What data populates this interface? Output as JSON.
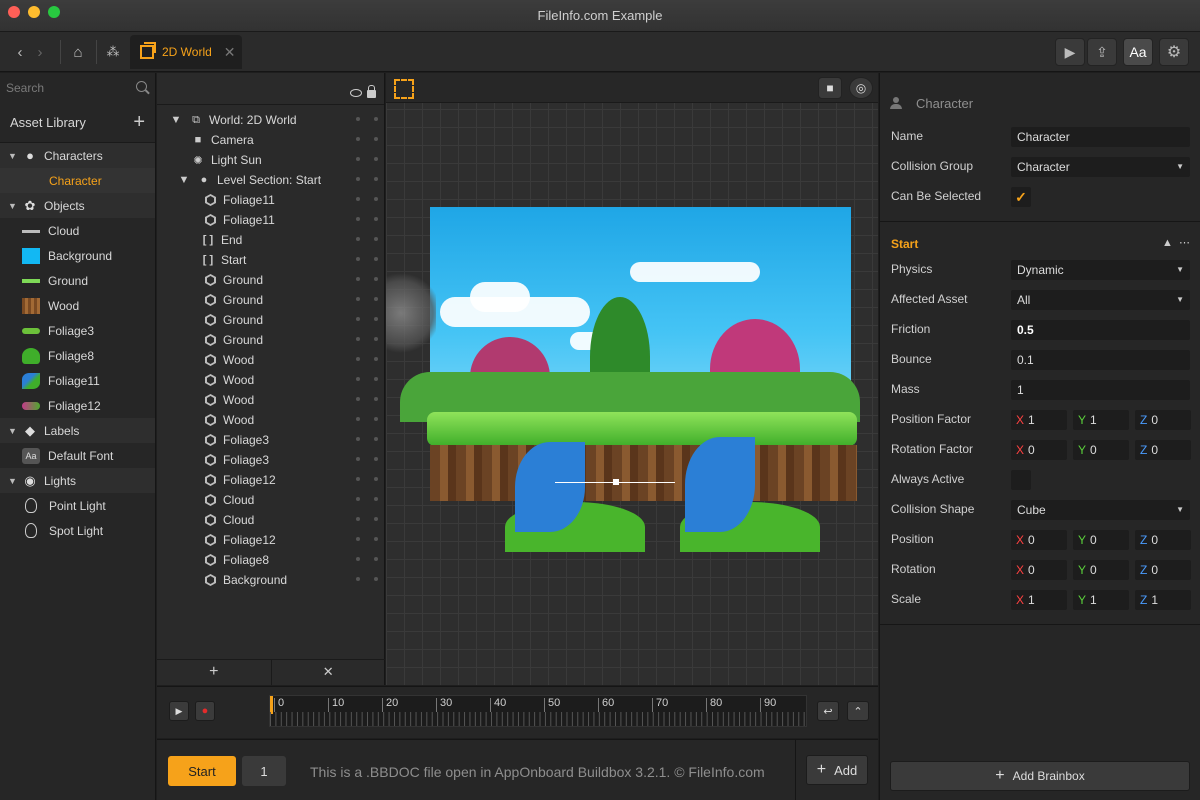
{
  "window": {
    "title": "FileInfo.com Example"
  },
  "toolbar": {
    "tab_label": "2D World",
    "tab_close": "✕"
  },
  "assets": {
    "search_placeholder": "Search",
    "header": "Asset Library",
    "groups": [
      {
        "label": "Characters",
        "items": [
          "Character"
        ]
      },
      {
        "label": "Objects",
        "items": [
          "Cloud",
          "Background",
          "Ground",
          "Wood",
          "Foliage3",
          "Foliage8",
          "Foliage11",
          "Foliage12"
        ]
      },
      {
        "label": "Labels",
        "items": [
          "Default Font"
        ]
      },
      {
        "label": "Lights",
        "items": [
          "Point Light",
          "Spot Light"
        ]
      }
    ]
  },
  "tree": {
    "world": "World: 2D World",
    "camera": "Camera",
    "light": "Light Sun",
    "section": "Level Section: Start",
    "objects": [
      {
        "icon": "hex",
        "label": "Foliage11"
      },
      {
        "icon": "hex",
        "label": "Foliage11"
      },
      {
        "icon": "bracket",
        "label": "End"
      },
      {
        "icon": "bracket",
        "label": "Start"
      },
      {
        "icon": "hex",
        "label": "Ground"
      },
      {
        "icon": "hex",
        "label": "Ground"
      },
      {
        "icon": "hex",
        "label": "Ground"
      },
      {
        "icon": "hex",
        "label": "Ground"
      },
      {
        "icon": "hex",
        "label": "Wood"
      },
      {
        "icon": "hex",
        "label": "Wood"
      },
      {
        "icon": "hex",
        "label": "Wood"
      },
      {
        "icon": "hex",
        "label": "Wood"
      },
      {
        "icon": "hex",
        "label": "Foliage3"
      },
      {
        "icon": "hex",
        "label": "Foliage3"
      },
      {
        "icon": "hex",
        "label": "Foliage12"
      },
      {
        "icon": "hex",
        "label": "Cloud"
      },
      {
        "icon": "hex",
        "label": "Cloud"
      },
      {
        "icon": "hex",
        "label": "Foliage12"
      },
      {
        "icon": "hex",
        "label": "Foliage8"
      },
      {
        "icon": "hex",
        "label": "Background"
      }
    ],
    "footer_add": "+",
    "footer_remove": "✕"
  },
  "timeline": {
    "labels": [
      "0",
      "10",
      "20",
      "30",
      "40",
      "50",
      "60",
      "70",
      "80",
      "90"
    ]
  },
  "bottom": {
    "start_label": "Start",
    "number": "1",
    "notice": "This is a .BBDOC file open in AppOnboard Buildbox 3.2.1. © FileInfo.com",
    "add_label": "Add"
  },
  "props": {
    "title": "Character",
    "name_label": "Name",
    "name_value": "Character",
    "group_label": "Collision Group",
    "group_value": "Character",
    "selectable_label": "Can Be Selected",
    "selectable_check": "✓",
    "section": "Start",
    "physics_label": "Physics",
    "physics_value": "Dynamic",
    "affected_label": "Affected Asset",
    "affected_value": "All",
    "friction_label": "Friction",
    "friction_value": "0.5",
    "bounce_label": "Bounce",
    "bounce_value": "0.1",
    "mass_label": "Mass",
    "mass_value": "1",
    "posfactor_label": "Position Factor",
    "posfactor": [
      "1",
      "1",
      "0"
    ],
    "rotfactor_label": "Rotation Factor",
    "rotfactor": [
      "0",
      "0",
      "0"
    ],
    "always_label": "Always Active",
    "shape_label": "Collision Shape",
    "shape_value": "Cube",
    "position_label": "Position",
    "position": [
      "0",
      "0",
      "0"
    ],
    "rotation_label": "Rotation",
    "rotation": [
      "0",
      "0",
      "0"
    ],
    "scale_label": "Scale",
    "scale": [
      "1",
      "1",
      "1"
    ],
    "axis": [
      "X",
      "Y",
      "Z"
    ],
    "brainbox_label": "Add Brainbox"
  },
  "colors": {
    "accent": "#f6a21a",
    "x_axis": "#ff4141",
    "y_axis": "#5bd13b",
    "z_axis": "#4a9cff"
  }
}
